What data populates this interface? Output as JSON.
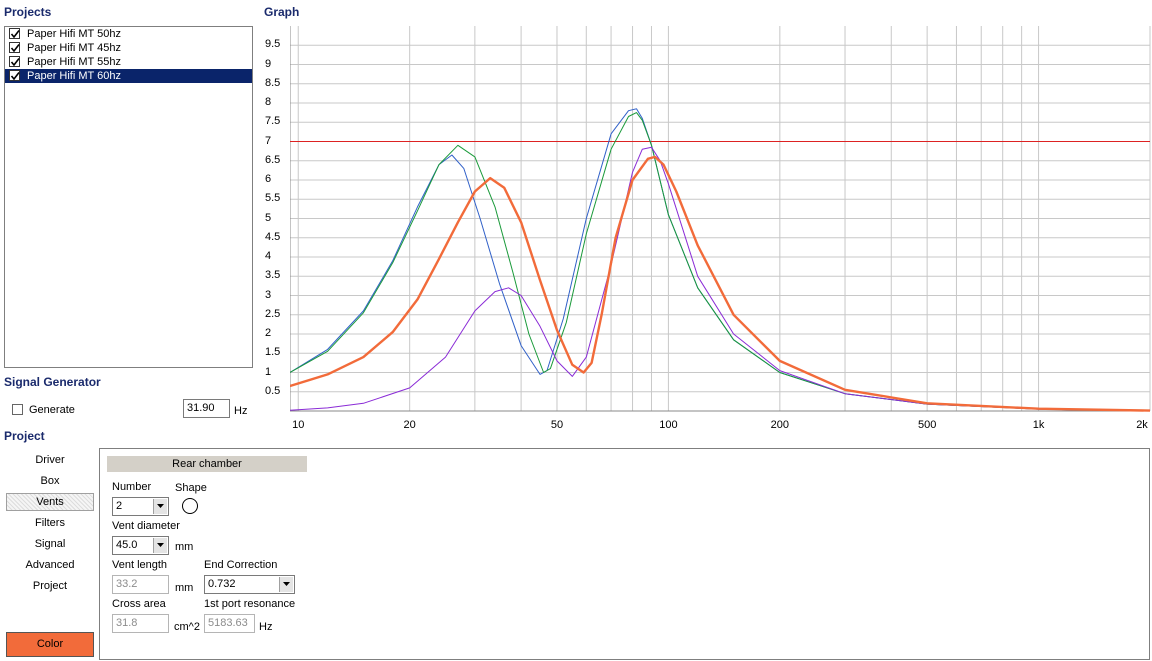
{
  "sections": {
    "projects": "Projects",
    "graph": "Graph",
    "signal_generator": "Signal Generator",
    "project": "Project"
  },
  "projects": [
    {
      "name": "Paper Hifi MT 50hz",
      "checked": true,
      "selected": false
    },
    {
      "name": "Paper Hifi MT 45hz",
      "checked": true,
      "selected": false
    },
    {
      "name": "Paper Hifi MT 55hz",
      "checked": true,
      "selected": false
    },
    {
      "name": "Paper Hifi MT 60hz",
      "checked": true,
      "selected": true
    }
  ],
  "signal": {
    "generate_label": "Generate",
    "generate_checked": false,
    "frequency": "31.90",
    "unit": "Hz"
  },
  "nav": [
    "Driver",
    "Box",
    "Vents",
    "Filters",
    "Signal",
    "Advanced",
    "Project"
  ],
  "nav_active": "Vents",
  "color_button": "Color",
  "accent_color": "#f26b3a",
  "vents": {
    "tab": "Rear chamber",
    "number_label": "Number",
    "number_value": "2",
    "shape_label": "Shape",
    "diameter_label": "Vent diameter",
    "diameter_value": "45.0",
    "diameter_unit": "mm",
    "length_label": "Vent length",
    "length_value": "33.2",
    "length_unit": "mm",
    "end_correction_label": "End Correction",
    "end_correction_value": "0.732",
    "cross_area_label": "Cross area",
    "cross_area_value": "31.8",
    "cross_area_unit": "cm^2",
    "port_resonance_label": "1st port resonance",
    "port_resonance_value": "5183.63",
    "port_resonance_unit": "Hz"
  },
  "chart_data": {
    "type": "line",
    "xscale": "log",
    "xlim": [
      9.5,
      2000
    ],
    "ylim": [
      0,
      10
    ],
    "x_tick_labels": [
      {
        "v": 10,
        "t": "10"
      },
      {
        "v": 20,
        "t": "20"
      },
      {
        "v": 50,
        "t": "50"
      },
      {
        "v": 100,
        "t": "100"
      },
      {
        "v": 200,
        "t": "200"
      },
      {
        "v": 500,
        "t": "500"
      },
      {
        "v": 1000,
        "t": "1k"
      },
      {
        "v": 2000,
        "t": "2k"
      }
    ],
    "y_ticks": [
      0.5,
      1,
      1.5,
      2,
      2.5,
      3,
      3.5,
      4,
      4.5,
      5,
      5.5,
      6,
      6.5,
      7,
      7.5,
      8,
      8.5,
      9,
      9.5
    ],
    "y_tick_labels": [
      "0.5",
      "1",
      "1.5",
      "2",
      "2.5",
      "3",
      "3.5",
      "4",
      "4.5",
      "5",
      "5.5",
      "6",
      "6.5",
      "7",
      "7.5",
      "8",
      "8.5",
      "9",
      "9.5"
    ],
    "grid": true,
    "reference_line": {
      "y": 7,
      "color": "#dd2222"
    },
    "series": [
      {
        "color": "#3060c8",
        "width": 1,
        "x": [
          9.5,
          12,
          15,
          18,
          21,
          24,
          26,
          28,
          31,
          35,
          40,
          45,
          47,
          52,
          60,
          70,
          78,
          82,
          85,
          90,
          100,
          120,
          150,
          200,
          300,
          500,
          1000,
          2000
        ],
        "y": [
          1.0,
          1.6,
          2.6,
          3.9,
          5.3,
          6.4,
          6.65,
          6.3,
          5.0,
          3.3,
          1.7,
          0.95,
          1.05,
          2.4,
          5.0,
          7.2,
          7.8,
          7.85,
          7.6,
          6.9,
          5.1,
          3.2,
          1.85,
          1.0,
          0.45,
          0.18,
          0.05,
          0.0
        ]
      },
      {
        "color": "#1a9a3a",
        "width": 1,
        "x": [
          9.5,
          12,
          15,
          18,
          21,
          24,
          27,
          30,
          34,
          38,
          42,
          46,
          48,
          53,
          60,
          70,
          78,
          82,
          85,
          90,
          100,
          120,
          150,
          200,
          300,
          500,
          1000,
          2000
        ],
        "y": [
          1.0,
          1.55,
          2.55,
          3.85,
          5.2,
          6.4,
          6.9,
          6.6,
          5.3,
          3.6,
          2.0,
          1.0,
          1.1,
          2.3,
          4.6,
          6.8,
          7.65,
          7.75,
          7.55,
          6.9,
          5.1,
          3.2,
          1.85,
          1.0,
          0.45,
          0.18,
          0.05,
          0.0
        ]
      },
      {
        "color": "#8a2bd6",
        "width": 1,
        "x": [
          9.5,
          12,
          15,
          20,
          25,
          30,
          34,
          37,
          40,
          45,
          50,
          55,
          60,
          70,
          80,
          85,
          90,
          95,
          100,
          120,
          150,
          200,
          300,
          500,
          1000,
          2000
        ],
        "y": [
          0.02,
          0.08,
          0.2,
          0.6,
          1.4,
          2.6,
          3.1,
          3.2,
          3.0,
          2.2,
          1.3,
          0.9,
          1.4,
          3.8,
          6.2,
          6.8,
          6.85,
          6.5,
          5.9,
          3.5,
          2.0,
          1.05,
          0.45,
          0.18,
          0.05,
          0.0
        ]
      },
      {
        "color": "#f26b3a",
        "width": 2.4,
        "x": [
          9.5,
          12,
          15,
          18,
          21,
          24,
          27,
          30,
          33,
          36,
          40,
          45,
          50,
          55,
          59,
          62,
          66,
          72,
          80,
          88,
          92,
          97,
          105,
          120,
          150,
          200,
          300,
          500,
          1000,
          2000
        ],
        "y": [
          0.65,
          0.95,
          1.4,
          2.05,
          2.9,
          3.95,
          4.9,
          5.7,
          6.05,
          5.8,
          4.9,
          3.4,
          2.1,
          1.2,
          1.0,
          1.25,
          2.5,
          4.5,
          6.0,
          6.55,
          6.6,
          6.4,
          5.7,
          4.3,
          2.5,
          1.3,
          0.55,
          0.2,
          0.06,
          0.01
        ]
      }
    ]
  }
}
